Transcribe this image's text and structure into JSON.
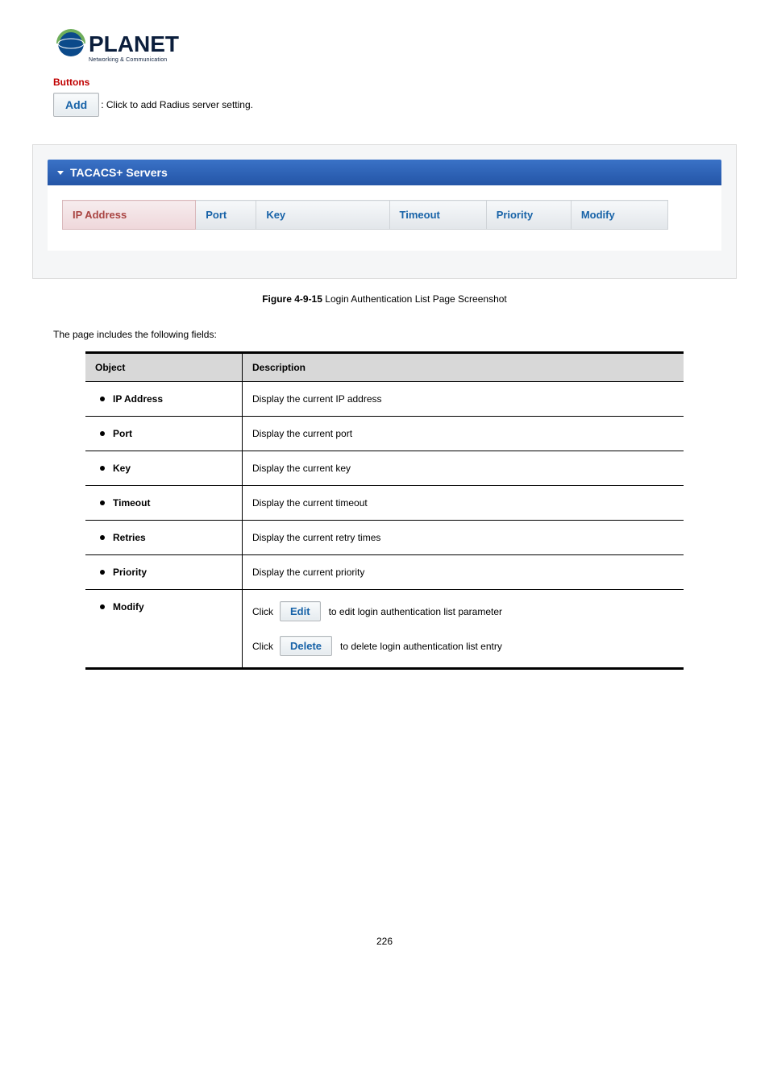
{
  "logo": {
    "name": "PLANET",
    "tagline": "Networking & Communication"
  },
  "buttons_section": {
    "heading": "Buttons",
    "add_label": "Add",
    "add_desc_prefix": ": ",
    "add_desc": "Click to add Radius server setting."
  },
  "screenshot": {
    "panel_title": "TACACS+ Servers",
    "columns": {
      "ip": "IP Address",
      "port": "Port",
      "key": "Key",
      "timeout": "Timeout",
      "priority": "Priority",
      "modify": "Modify"
    }
  },
  "figure": {
    "number": "Figure 4-9-15",
    "text": "Login Authentication List Page Screenshot"
  },
  "intro": "The page includes the following fields:",
  "fields_table": {
    "headers": {
      "object": "Object",
      "description": "Description"
    },
    "rows": [
      {
        "object": "IP Address",
        "description": "Display the current IP address"
      },
      {
        "object": "Port",
        "description": "Display the current port"
      },
      {
        "object": "Key",
        "description": "Display the current key"
      },
      {
        "object": "Timeout",
        "description": "Display the current timeout"
      },
      {
        "object": "Retries",
        "description": "Display the current retry times"
      },
      {
        "object": "Priority",
        "description": "Display the current priority"
      }
    ],
    "modify_row": {
      "object": "Modify",
      "edit_button": "Edit",
      "edit_desc_prefix": "Click ",
      "edit_desc_suffix": " to edit login authentication list parameter",
      "delete_button": "Delete",
      "delete_desc_prefix": "Click ",
      "delete_desc_suffix": " to delete login authentication list entry"
    }
  },
  "page_number": "226"
}
